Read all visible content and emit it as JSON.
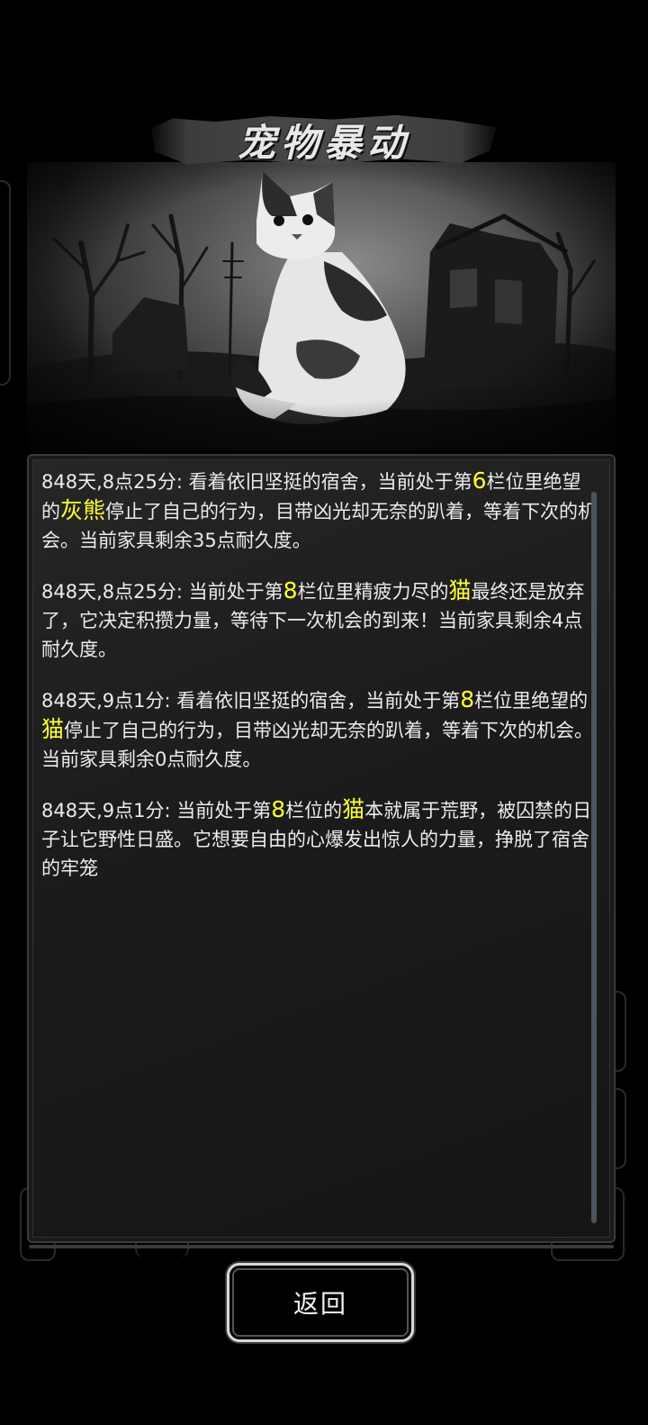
{
  "dialog": {
    "title": "宠物暴动",
    "back_label": "返回"
  },
  "scene": {
    "image": "calico-cat-ruins-illustration"
  },
  "log": {
    "highlight_color": "#ffff33",
    "entries": [
      {
        "prefix": "848天,8点25分: 看着依旧坚挺的宿舍，当前处于第",
        "slot": "6",
        "mid": "栏位里绝望的",
        "pet": "灰熊",
        "suffix": "停止了自己的行为，目带凶光却无奈的趴着，等着下次的机会。当前家具剩余35点耐久度。"
      },
      {
        "prefix": "848天,8点25分: 当前处于第",
        "slot": "8",
        "mid": "栏位里精疲力尽的",
        "pet": "猫",
        "suffix": "最终还是放弃了，它决定积攒力量，等待下一次机会的到来！当前家具剩余4点耐久度。"
      },
      {
        "prefix": "848天,9点1分: 看着依旧坚挺的宿舍，当前处于第",
        "slot": "8",
        "mid": "栏位里绝望的",
        "pet": "猫",
        "suffix": "停止了自己的行为，目带凶光却无奈的趴着，等着下次的机会。当前家具剩余0点耐久度。"
      },
      {
        "prefix": "848天,9点1分: 当前处于第",
        "slot": "8",
        "mid": "栏位的",
        "pet": "猫",
        "suffix": "本就属于荒野，被囚禁的日子让它野性日盛。它想要自由的心爆发出惊人的力量，挣脱了宿舍的牢笼"
      }
    ]
  }
}
